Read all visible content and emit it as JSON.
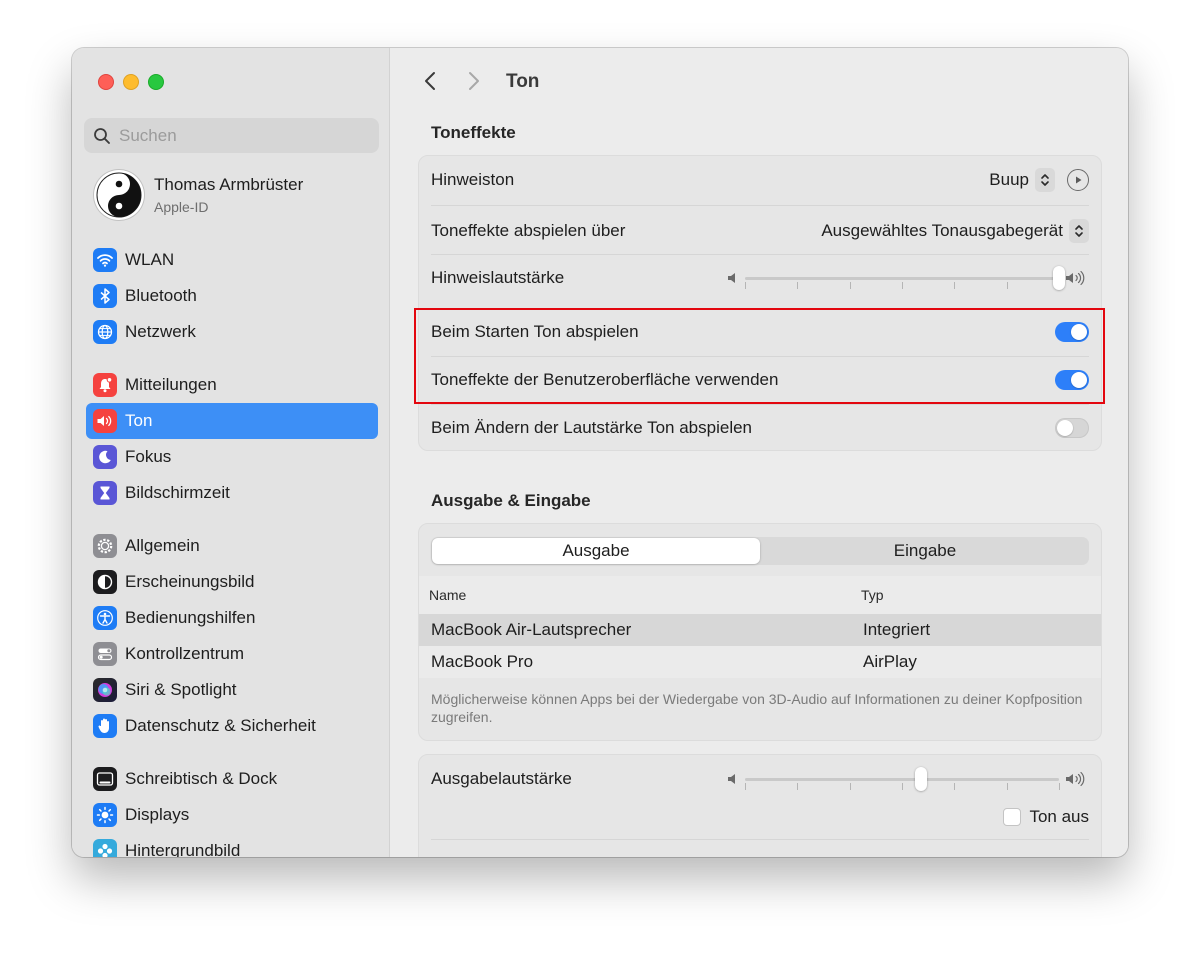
{
  "window": {
    "traffic_lights": [
      "close",
      "minimize",
      "zoom"
    ]
  },
  "sidebar": {
    "search": {
      "placeholder": "Suchen"
    },
    "account": {
      "name": "Thomas Armbrüster",
      "subtitle": "Apple-ID"
    },
    "groups": [
      [
        {
          "label": "WLAN",
          "icon": "wifi-icon",
          "color": "#1e7cf5"
        },
        {
          "label": "Bluetooth",
          "icon": "bluetooth-icon",
          "color": "#1e7cf5"
        },
        {
          "label": "Netzwerk",
          "icon": "globe-icon",
          "color": "#1e7cf5"
        }
      ],
      [
        {
          "label": "Mitteilungen",
          "icon": "bell-icon",
          "color": "#f5423f"
        },
        {
          "label": "Ton",
          "icon": "speaker-icon",
          "color": "#f5423f",
          "selected": true
        },
        {
          "label": "Fokus",
          "icon": "moon-icon",
          "color": "#5a56d6"
        },
        {
          "label": "Bildschirmzeit",
          "icon": "hourglass-icon",
          "color": "#5a56d6"
        }
      ],
      [
        {
          "label": "Allgemein",
          "icon": "gear-icon",
          "color": "#8e8e93"
        },
        {
          "label": "Erscheinungsbild",
          "icon": "appearance-icon",
          "color": "#1c1c1e"
        },
        {
          "label": "Bedienungshilfen",
          "icon": "accessibility-icon",
          "color": "#1e7cf5"
        },
        {
          "label": "Kontrollzentrum",
          "icon": "control-center-icon",
          "color": "#8e8e93"
        },
        {
          "label": "Siri & Spotlight",
          "icon": "siri-icon",
          "color": "#7a3df0"
        },
        {
          "label": "Datenschutz & Sicherheit",
          "icon": "hand-icon",
          "color": "#1e7cf5"
        }
      ],
      [
        {
          "label": "Schreibtisch & Dock",
          "icon": "dock-icon",
          "color": "#1c1c1e"
        },
        {
          "label": "Displays",
          "icon": "sun-icon",
          "color": "#1e7cf5"
        },
        {
          "label": "Hintergrundbild",
          "icon": "wallpaper-icon",
          "color": "#35aadc"
        }
      ]
    ]
  },
  "toolbar": {
    "title": "Ton"
  },
  "toneffekte": {
    "section_title": "Toneffekte",
    "hinweiston": {
      "label": "Hinweiston",
      "value": "Buup"
    },
    "abspielen_ueber": {
      "label": "Toneffekte abspielen über",
      "value": "Ausgewähltes Tonausgabegerät"
    },
    "hinweislautstaerke": {
      "label": "Hinweislautstärke",
      "level": 1.0
    },
    "beim_starten": {
      "label": "Beim Starten Ton abspielen",
      "on": true
    },
    "ui_effekte": {
      "label": "Toneffekte der Benutzeroberfläche verwenden",
      "on": true
    },
    "lautstaerke_aendern": {
      "label": "Beim Ändern der Lautstärke Ton abspielen",
      "on": false
    }
  },
  "ausgabe_eingabe": {
    "section_title": "Ausgabe & Eingabe",
    "tabs": [
      "Ausgabe",
      "Eingabe"
    ],
    "active_tab": "Ausgabe",
    "columns": [
      "Name",
      "Typ"
    ],
    "rows": [
      {
        "name": "MacBook Air-Lautsprecher",
        "type": "Integriert",
        "selected": true
      },
      {
        "name": "MacBook Pro",
        "type": "AirPlay",
        "selected": false
      }
    ],
    "note": "Möglicherweise können Apps bei der Wiedergabe von 3D-Audio auf Informationen zu deiner Kopfposition zugreifen."
  },
  "ausgabelautstaerke": {
    "label": "Ausgabelautstärke",
    "level": 0.56,
    "mute_label": "Ton aus",
    "muted": false
  },
  "accent_color": "#2d7ff9",
  "highlight_color": "#e3060e"
}
